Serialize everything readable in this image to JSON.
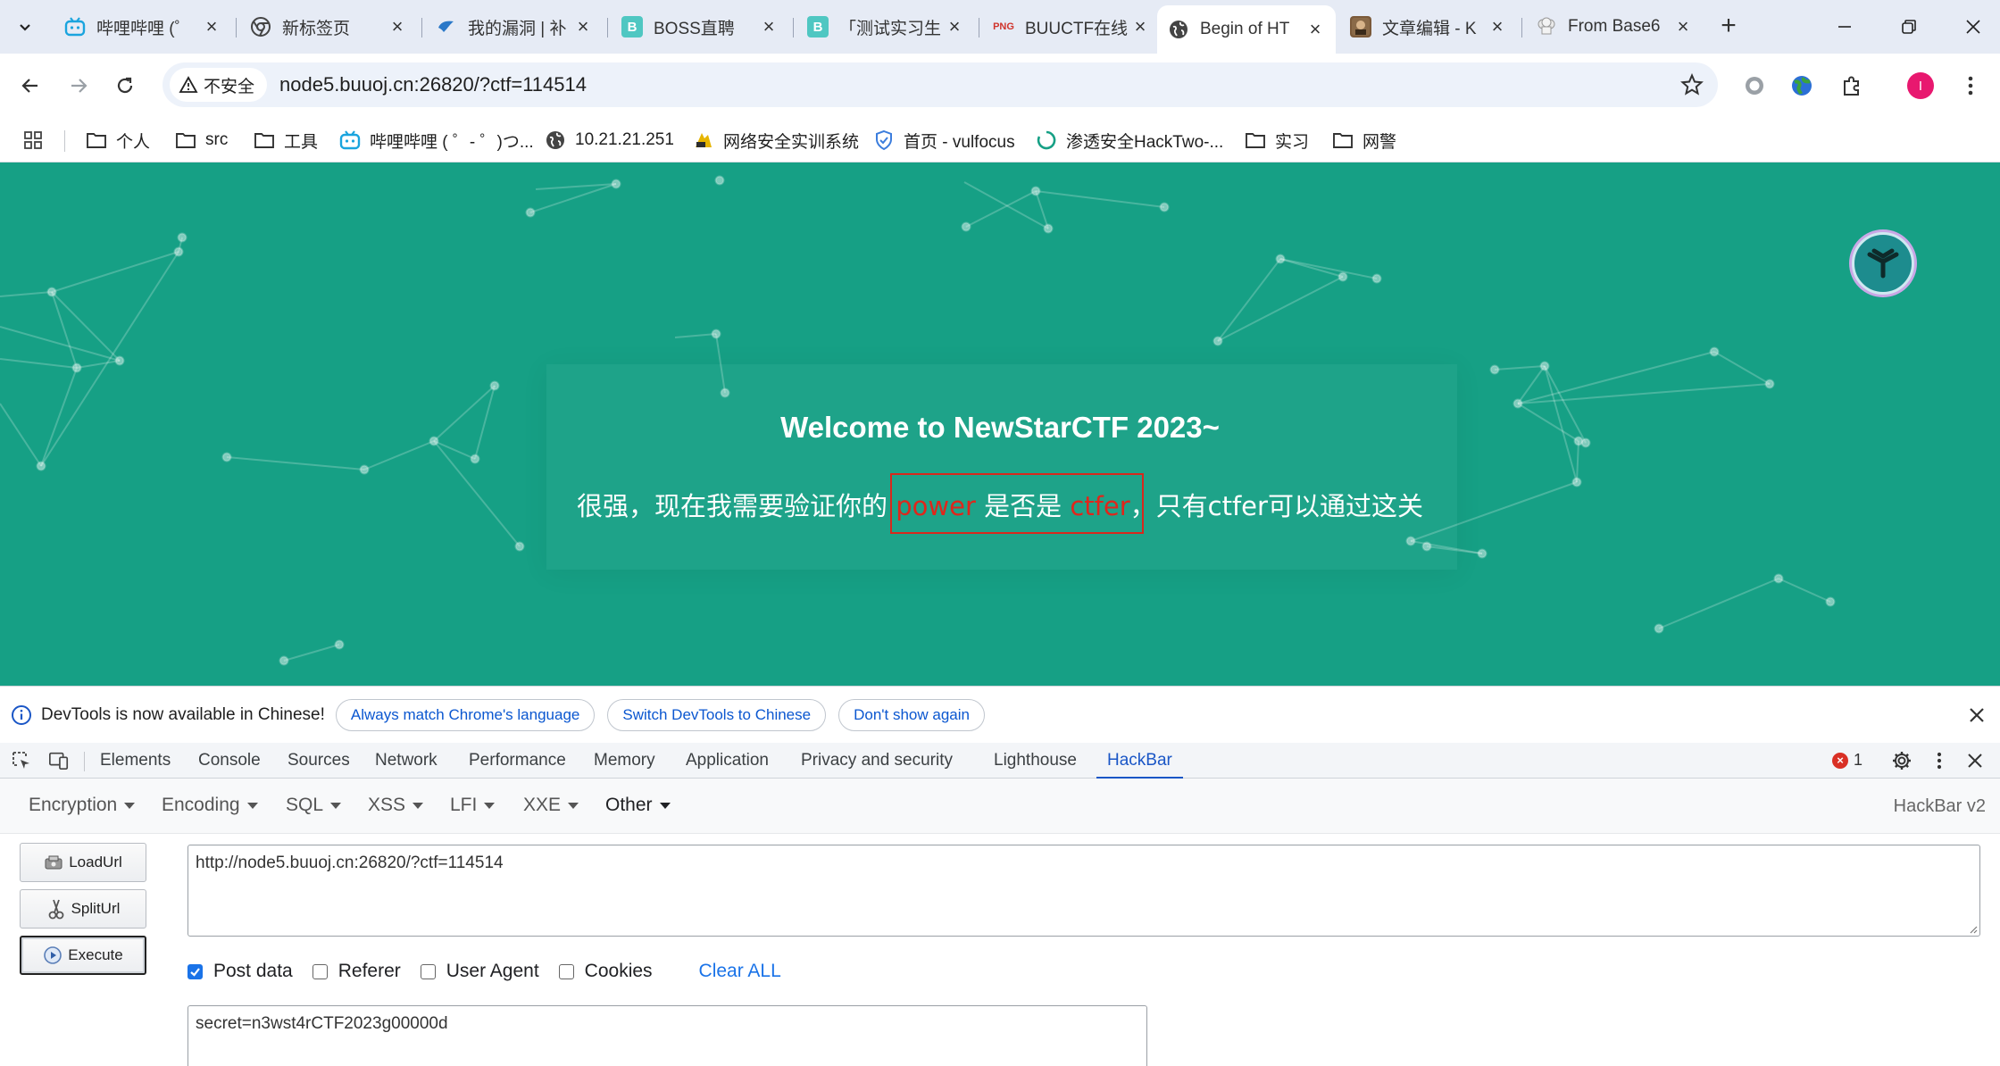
{
  "tabs": [
    {
      "title": "哔哩哔哩 (゜",
      "favicon": "bilibili-icon"
    },
    {
      "title": "新标签页",
      "favicon": "chrome-icon"
    },
    {
      "title": "我的漏洞 | 补",
      "favicon": "bird-icon"
    },
    {
      "title": "BOSS直聘",
      "favicon": "boss-icon"
    },
    {
      "title": "「测试实习生",
      "favicon": "boss-icon"
    },
    {
      "title": "BUUCTF在线",
      "favicon": "buuctf-icon"
    },
    {
      "title": "Begin of HT",
      "favicon": "globe-icon"
    },
    {
      "title": "文章编辑 - K",
      "favicon": "article-icon"
    },
    {
      "title": "From Base6",
      "favicon": "chef-icon"
    }
  ],
  "address": {
    "security_label": "不安全",
    "url": "node5.buuoj.cn:26820/?ctf=114514"
  },
  "profile": {
    "initial": "I",
    "color": "#e8186f"
  },
  "bookmarks": [
    {
      "label": "个人",
      "icon": "folder-icon"
    },
    {
      "label": "src",
      "icon": "folder-icon"
    },
    {
      "label": "工具",
      "icon": "folder-icon"
    },
    {
      "label": "哔哩哔哩 ( ゜- ゜)つ...",
      "icon": "bilibili-icon"
    },
    {
      "label": "10.21.21.251",
      "icon": "globe-icon"
    },
    {
      "label": "网络安全实训系统",
      "icon": "training-icon"
    },
    {
      "label": "首页 - vulfocus",
      "icon": "shield-icon"
    },
    {
      "label": "渗透安全HackTwo-...",
      "icon": "loading-icon"
    },
    {
      "label": "实习",
      "icon": "folder-icon"
    },
    {
      "label": "网警",
      "icon": "folder-icon"
    }
  ],
  "page": {
    "background": "#16a085",
    "welcome": "Welcome to NewStarCTF 2023~",
    "challenge": {
      "prefix": "很强，现在我需要验证你的",
      "word1": "power",
      "middle": "是否是",
      "word2": "ctfer",
      "suffix": "，只有ctfer可以通过这关"
    }
  },
  "devtools": {
    "infobar": {
      "message": "DevTools is now available in Chinese!",
      "buttons": [
        "Always match Chrome's language",
        "Switch DevTools to Chinese",
        "Don't show again"
      ]
    },
    "tabs": [
      "Elements",
      "Console",
      "Sources",
      "Network",
      "Performance",
      "Memory",
      "Application",
      "Privacy and security",
      "Lighthouse",
      "HackBar"
    ],
    "active_tab": "HackBar",
    "error_count": "1"
  },
  "hackbar": {
    "menu": [
      "Encryption",
      "Encoding",
      "SQL",
      "XSS",
      "LFI",
      "XXE",
      "Other"
    ],
    "brand": "HackBar v2",
    "buttons": {
      "load": "LoadUrl",
      "split": "SplitUrl",
      "execute": "Execute"
    },
    "url_value": "http://node5.buuoj.cn:26820/?ctf=114514",
    "options": [
      {
        "label": "Post data",
        "checked": true
      },
      {
        "label": "Referer",
        "checked": false
      },
      {
        "label": "User Agent",
        "checked": false
      },
      {
        "label": "Cookies",
        "checked": false
      }
    ],
    "clear_all": "Clear ALL",
    "post_value": "secret=n3wst4rCTF2023g00000d"
  }
}
